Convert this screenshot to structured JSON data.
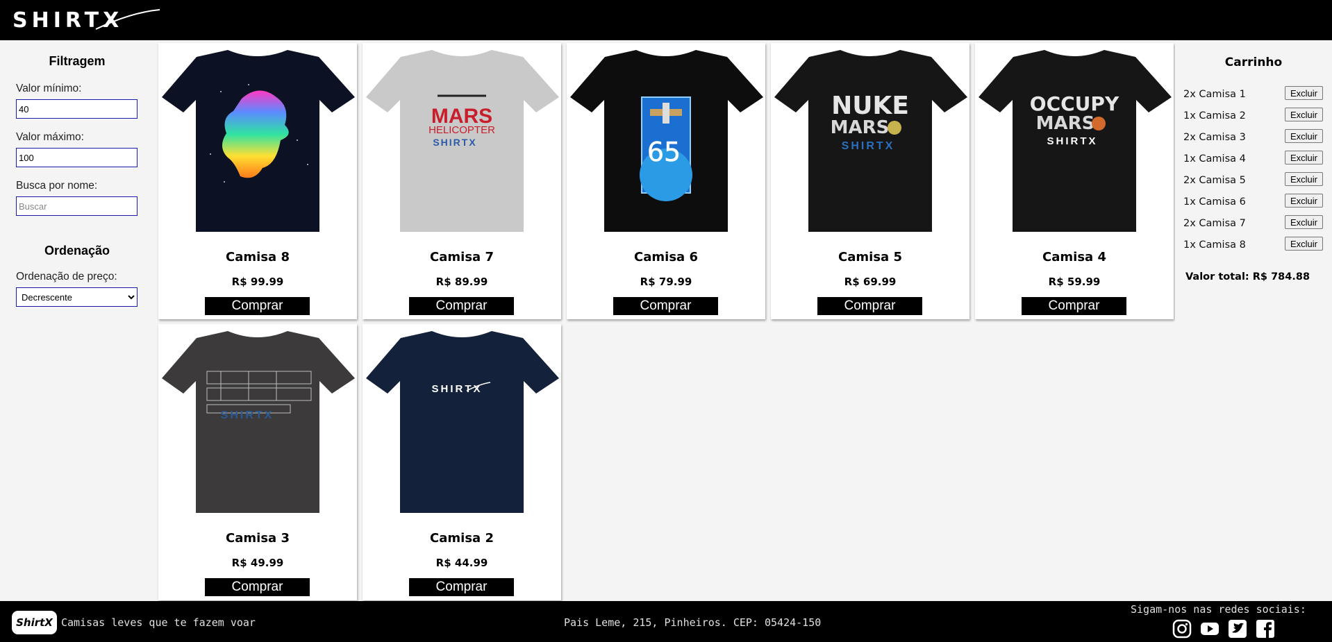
{
  "header": {
    "logo_text": "SHIRTX"
  },
  "filters": {
    "title": "Filtragem",
    "min_label": "Valor mínimo:",
    "min_value": "40",
    "max_label": "Valor máximo:",
    "max_value": "100",
    "search_label": "Busca por nome:",
    "search_placeholder": "Buscar",
    "sort_title": "Ordenação",
    "sort_label": "Ordenação de preço:",
    "sort_selected": "Decrescente"
  },
  "products": [
    {
      "name": "Camisa 8",
      "price": "R$ 99.99",
      "buy_label": "Comprar",
      "shirt_color": "#0c1224",
      "print": "rainbow-astronaut"
    },
    {
      "name": "Camisa 7",
      "price": "R$ 89.99",
      "buy_label": "Comprar",
      "shirt_color": "#c9c9c9",
      "print": "mars-helicopter"
    },
    {
      "name": "Camisa 6",
      "price": "R$ 79.99",
      "buy_label": "Comprar",
      "shirt_color": "#0d0d0d",
      "print": "iss-65-patch"
    },
    {
      "name": "Camisa 5",
      "price": "R$ 69.99",
      "buy_label": "Comprar",
      "shirt_color": "#161616",
      "print": "nuke-mars"
    },
    {
      "name": "Camisa 4",
      "price": "R$ 59.99",
      "buy_label": "Comprar",
      "shirt_color": "#161616",
      "print": "occupy-mars"
    },
    {
      "name": "Camisa 3",
      "price": "R$ 49.99",
      "buy_label": "Comprar",
      "shirt_color": "#3c3a3a",
      "print": "rocket-blueprint"
    },
    {
      "name": "Camisa 2",
      "price": "R$ 44.99",
      "buy_label": "Comprar",
      "shirt_color": "#14213a",
      "print": "shirtx-logo"
    }
  ],
  "prints": {
    "mars_helicopter": [
      "MARS",
      "HELICOPTER",
      "SHIRTX"
    ],
    "iss_patch": "65",
    "nuke_mars": [
      "NUKE",
      "MARS",
      "SHIRTX"
    ],
    "occupy_mars": [
      "OCCUPY",
      "MARS",
      "SHIRTX"
    ],
    "blueprint": "SHIRTX",
    "logo": "SHIRTX"
  },
  "cart": {
    "title": "Carrinho",
    "items": [
      {
        "label": "2x Camisa 1",
        "delete_label": "Excluir"
      },
      {
        "label": "1x Camisa 2",
        "delete_label": "Excluir"
      },
      {
        "label": "2x Camisa 3",
        "delete_label": "Excluir"
      },
      {
        "label": "1x Camisa 4",
        "delete_label": "Excluir"
      },
      {
        "label": "2x Camisa 5",
        "delete_label": "Excluir"
      },
      {
        "label": "1x Camisa 6",
        "delete_label": "Excluir"
      },
      {
        "label": "2x Camisa 7",
        "delete_label": "Excluir"
      },
      {
        "label": "1x Camisa 8",
        "delete_label": "Excluir"
      }
    ],
    "total": "Valor total: R$ 784.88"
  },
  "footer": {
    "logo_text": "ShirtX",
    "slogan": "Camisas leves que te fazem voar",
    "address": "Pais Leme, 215, Pinheiros. CEP: 05424-150",
    "social_title": "Sigam-nos nas redes sociais:",
    "socials": [
      "instagram-icon",
      "youtube-icon",
      "twitter-icon",
      "facebook-icon"
    ]
  }
}
